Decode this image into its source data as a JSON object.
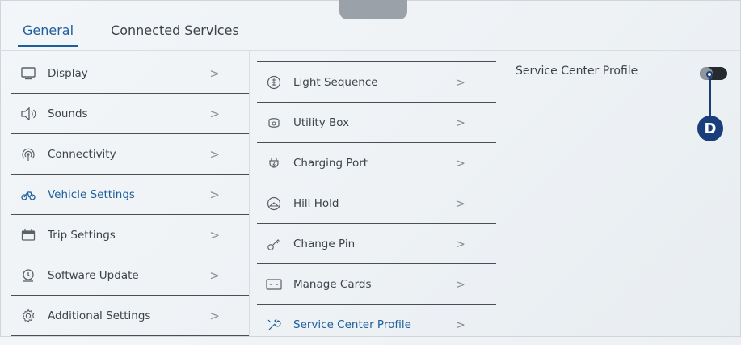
{
  "tabs": [
    {
      "label": "General",
      "active": true
    },
    {
      "label": "Connected Services",
      "active": false
    }
  ],
  "left_menu": [
    {
      "label": "Display",
      "icon": "display-icon"
    },
    {
      "label": "Sounds",
      "icon": "speaker-icon"
    },
    {
      "label": "Connectivity",
      "icon": "signal-icon"
    },
    {
      "label": "Vehicle Settings",
      "icon": "scooter-icon",
      "active": true
    },
    {
      "label": "Trip Settings",
      "icon": "trip-icon"
    },
    {
      "label": "Software Update",
      "icon": "update-icon"
    },
    {
      "label": "Additional Settings",
      "icon": "gear-icon"
    }
  ],
  "vehicle_menu": [
    {
      "label": "Light Sequence",
      "icon": "light-icon"
    },
    {
      "label": "Utility Box",
      "icon": "utility-box-icon"
    },
    {
      "label": "Charging Port",
      "icon": "plug-icon"
    },
    {
      "label": "Hill Hold",
      "icon": "hill-hold-icon"
    },
    {
      "label": "Change Pin",
      "icon": "key-icon"
    },
    {
      "label": "Manage Cards",
      "icon": "card-icon"
    },
    {
      "label": "Service Center Profile",
      "icon": "wrench-icon",
      "active": true
    }
  ],
  "chevron": ">",
  "detail": {
    "setting_label": "Service Center Profile",
    "toggle_on": false,
    "callout": "D"
  },
  "colors": {
    "accent": "#1d5f9c",
    "callout": "#1a3d7c",
    "toggle_track": "#262a2f"
  }
}
